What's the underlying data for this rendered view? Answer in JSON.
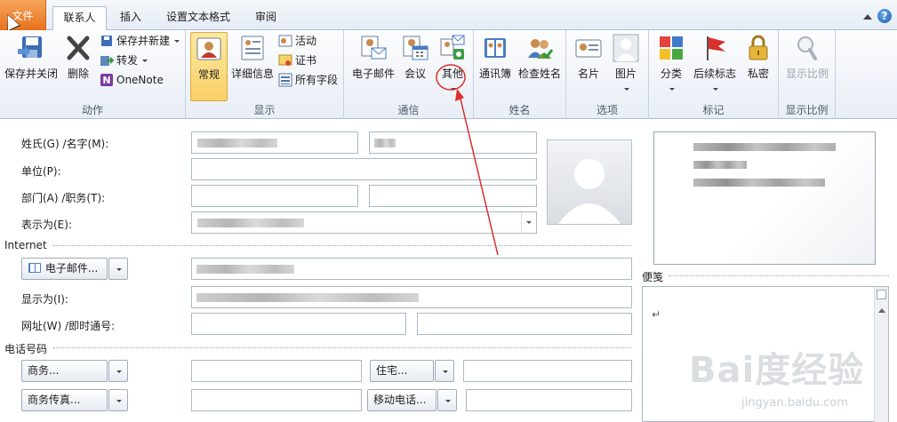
{
  "tabs": [
    {
      "label": "文件"
    },
    {
      "label": "联系人"
    },
    {
      "label": "插入"
    },
    {
      "label": "设置文本格式"
    },
    {
      "label": "审阅"
    }
  ],
  "ribbon": {
    "actions": {
      "label": "动作",
      "save_close": "保存并关闭",
      "delete": "删除",
      "save_new": "保存并新建",
      "forward": "转发",
      "onenote": "OneNote"
    },
    "show": {
      "label": "显示",
      "general": "常规",
      "details": "详细信息",
      "activities": "活动",
      "certificates": "证书",
      "all_fields": "所有字段"
    },
    "communicate": {
      "label": "通信",
      "email": "电子邮件",
      "meeting": "会议",
      "more": "其他"
    },
    "names": {
      "label": "姓名",
      "address_book": "通讯簿",
      "check_names": "检查姓名"
    },
    "options": {
      "label": "选项",
      "business_card": "名片",
      "picture": "图片"
    },
    "tags": {
      "label": "标记",
      "categorize": "分类",
      "follow_up": "后续标志",
      "private": "私密"
    },
    "zoom": {
      "label": "显示比例",
      "zoom": "显示比例"
    }
  },
  "form": {
    "name_label": "姓氏(G)  /名字(M):",
    "company_label": "单位(P):",
    "dept_label": "部门(A)  /职务(T):",
    "file_as_label": "表示为(E):",
    "internet_section": "Internet",
    "email_button": "电子邮件...",
    "display_as_label": "显示为(I):",
    "web_label": "网址(W)  /即时通号:",
    "phone_section": "电话号码",
    "business_button": "商务...",
    "home_button": "住宅...",
    "business_fax_button": "商务传真...",
    "mobile_button": "移动电话...",
    "notes_label": "便笺",
    "notes_text": "↵"
  },
  "watermark": {
    "brand": "Bai度经验",
    "site": "jingyan.baidu.com"
  },
  "colors": {
    "file_tab": "#e8711c",
    "selected_button": "#f9d067",
    "annotation": "#d9302c"
  }
}
